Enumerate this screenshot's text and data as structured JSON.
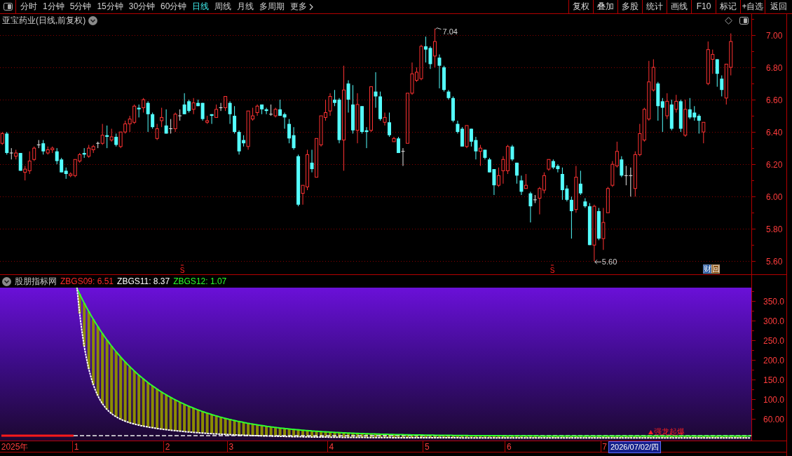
{
  "toolbar": {
    "periods": [
      {
        "label": "分时",
        "selected": false
      },
      {
        "label": "1分钟",
        "selected": false
      },
      {
        "label": "5分钟",
        "selected": false
      },
      {
        "label": "15分钟",
        "selected": false
      },
      {
        "label": "30分钟",
        "selected": false
      },
      {
        "label": "60分钟",
        "selected": false
      },
      {
        "label": "日线",
        "selected": true
      },
      {
        "label": "周线",
        "selected": false
      },
      {
        "label": "月线",
        "selected": false
      },
      {
        "label": "多周期",
        "selected": false
      }
    ],
    "more": {
      "label": "更多"
    },
    "actions": [
      "复权",
      "叠加",
      "多股",
      "统计",
      "画线",
      "F10",
      "标记",
      "+自选",
      "返回"
    ]
  },
  "main_chart": {
    "title": "亚宝药业(日线,前复权)",
    "chart_data": {
      "type": "candlestick",
      "ohlc": [
        [
          6.33,
          6.4,
          6.32,
          6.39
        ],
        [
          6.39,
          6.4,
          6.26,
          6.27
        ],
        [
          6.27,
          6.3,
          6.23,
          6.27
        ],
        [
          6.25,
          6.29,
          6.23,
          6.27
        ],
        [
          6.27,
          6.27,
          6.16,
          6.16
        ],
        [
          6.15,
          6.19,
          6.1,
          6.17
        ],
        [
          6.16,
          6.28,
          6.14,
          6.22
        ],
        [
          6.23,
          6.31,
          6.22,
          6.3
        ],
        [
          6.32,
          6.35,
          6.3,
          6.32
        ],
        [
          6.33,
          6.35,
          6.26,
          6.28
        ],
        [
          6.27,
          6.31,
          6.26,
          6.29
        ],
        [
          6.29,
          6.31,
          6.27,
          6.3
        ],
        [
          6.28,
          6.3,
          6.2,
          6.22
        ],
        [
          6.23,
          6.24,
          6.15,
          6.15
        ],
        [
          6.16,
          6.18,
          6.11,
          6.14
        ],
        [
          6.13,
          6.15,
          6.12,
          6.14
        ],
        [
          6.13,
          6.23,
          6.12,
          6.23
        ],
        [
          6.22,
          6.27,
          6.21,
          6.26
        ],
        [
          6.27,
          6.3,
          6.24,
          6.26
        ],
        [
          6.25,
          6.32,
          6.24,
          6.3
        ],
        [
          6.29,
          6.32,
          6.27,
          6.31
        ],
        [
          6.33,
          6.34,
          6.3,
          6.33
        ],
        [
          6.33,
          6.45,
          6.32,
          6.38
        ],
        [
          6.38,
          6.44,
          6.3,
          6.37
        ],
        [
          6.35,
          6.42,
          6.34,
          6.37
        ],
        [
          6.37,
          6.39,
          6.31,
          6.32
        ],
        [
          6.31,
          6.4,
          6.3,
          6.4
        ],
        [
          6.4,
          6.47,
          6.39,
          6.45
        ],
        [
          6.45,
          6.5,
          6.4,
          6.48
        ],
        [
          6.46,
          6.57,
          6.45,
          6.56
        ],
        [
          6.55,
          6.57,
          6.49,
          6.54
        ],
        [
          6.55,
          6.61,
          6.52,
          6.6
        ],
        [
          6.58,
          6.59,
          6.4,
          6.51
        ],
        [
          6.51,
          6.52,
          6.42,
          6.43
        ],
        [
          6.36,
          6.45,
          6.35,
          6.42
        ],
        [
          6.47,
          6.55,
          6.43,
          6.49
        ],
        [
          6.44,
          6.54,
          6.39,
          6.39
        ],
        [
          6.42,
          6.48,
          6.39,
          6.42
        ],
        [
          6.42,
          6.52,
          6.4,
          6.51
        ],
        [
          6.5,
          6.54,
          6.47,
          6.5
        ],
        [
          6.57,
          6.64,
          6.51,
          6.51
        ],
        [
          6.59,
          6.6,
          6.52,
          6.53
        ],
        [
          6.54,
          6.61,
          6.51,
          6.58
        ],
        [
          6.58,
          6.6,
          6.56,
          6.56
        ],
        [
          6.58,
          6.58,
          6.47,
          6.48
        ],
        [
          6.46,
          6.5,
          6.45,
          6.47
        ],
        [
          6.51,
          6.51,
          6.45,
          6.5
        ],
        [
          6.49,
          6.57,
          6.49,
          6.54
        ],
        [
          6.55,
          6.58,
          6.53,
          6.55
        ],
        [
          6.55,
          6.62,
          6.53,
          6.62
        ],
        [
          6.58,
          6.59,
          6.45,
          6.51
        ],
        [
          6.5,
          6.56,
          6.39,
          6.4
        ],
        [
          6.4,
          6.41,
          6.26,
          6.28
        ],
        [
          6.35,
          6.38,
          6.31,
          6.33
        ],
        [
          6.31,
          6.53,
          6.29,
          6.53
        ],
        [
          6.48,
          6.55,
          6.47,
          6.5
        ],
        [
          6.52,
          6.57,
          6.5,
          6.56
        ],
        [
          6.57,
          6.57,
          6.51,
          6.54
        ],
        [
          6.54,
          6.55,
          6.51,
          6.53
        ],
        [
          6.51,
          6.57,
          6.5,
          6.51
        ],
        [
          6.5,
          6.55,
          6.49,
          6.54
        ],
        [
          6.54,
          6.6,
          6.5,
          6.5
        ],
        [
          6.51,
          6.52,
          6.42,
          6.49
        ],
        [
          6.45,
          6.48,
          6.33,
          6.36
        ],
        [
          6.38,
          6.43,
          6.29,
          6.3
        ],
        [
          6.25,
          6.26,
          5.94,
          5.95
        ],
        [
          6.02,
          6.07,
          5.95,
          6.07
        ],
        [
          6.06,
          6.29,
          6.04,
          6.26
        ],
        [
          6.21,
          6.29,
          6.15,
          6.17
        ],
        [
          6.12,
          6.36,
          6.12,
          6.36
        ],
        [
          6.32,
          6.5,
          6.31,
          6.5
        ],
        [
          6.49,
          6.6,
          6.47,
          6.52
        ],
        [
          6.53,
          6.64,
          6.5,
          6.62
        ],
        [
          6.6,
          6.66,
          6.56,
          6.58
        ],
        [
          6.6,
          6.61,
          6.33,
          6.35
        ],
        [
          6.35,
          6.81,
          6.16,
          6.66
        ],
        [
          6.7,
          6.72,
          6.52,
          6.6
        ],
        [
          6.57,
          6.69,
          6.39,
          6.41
        ],
        [
          6.41,
          6.64,
          6.33,
          6.57
        ],
        [
          6.56,
          6.56,
          6.39,
          6.4
        ],
        [
          6.41,
          6.43,
          6.3,
          6.4
        ],
        [
          6.41,
          6.68,
          6.4,
          6.68
        ],
        [
          6.65,
          6.77,
          6.55,
          6.62
        ],
        [
          6.62,
          6.65,
          6.47,
          6.48
        ],
        [
          6.46,
          6.52,
          6.44,
          6.49
        ],
        [
          6.46,
          6.52,
          6.37,
          6.38
        ],
        [
          6.34,
          6.37,
          6.34,
          6.36
        ],
        [
          6.36,
          6.37,
          6.27,
          6.27
        ],
        [
          6.28,
          6.3,
          6.19,
          6.28
        ],
        [
          6.33,
          6.64,
          6.33,
          6.64
        ],
        [
          6.64,
          6.83,
          6.63,
          6.76
        ],
        [
          6.72,
          6.8,
          6.71,
          6.77
        ],
        [
          6.73,
          6.94,
          6.72,
          6.93
        ],
        [
          6.93,
          6.99,
          6.83,
          6.91
        ],
        [
          6.92,
          6.93,
          6.79,
          6.82
        ],
        [
          6.87,
          7.04,
          6.8,
          6.96
        ],
        [
          6.86,
          6.88,
          6.67,
          6.81
        ],
        [
          6.8,
          6.81,
          6.65,
          6.66
        ],
        [
          6.65,
          6.66,
          6.6,
          6.61
        ],
        [
          6.61,
          6.62,
          6.46,
          6.47
        ],
        [
          6.45,
          6.47,
          6.39,
          6.4
        ],
        [
          6.42,
          6.43,
          6.31,
          6.31
        ],
        [
          6.31,
          6.44,
          6.3,
          6.44
        ],
        [
          6.42,
          6.42,
          6.31,
          6.34
        ],
        [
          6.35,
          6.37,
          6.23,
          6.28
        ],
        [
          6.28,
          6.32,
          6.19,
          6.3
        ],
        [
          6.29,
          6.29,
          6.23,
          6.24
        ],
        [
          6.23,
          6.24,
          6.15,
          6.15
        ],
        [
          6.17,
          6.17,
          6.01,
          6.07
        ],
        [
          6.07,
          6.18,
          6.06,
          6.13
        ],
        [
          6.16,
          6.25,
          6.08,
          6.23
        ],
        [
          6.16,
          6.32,
          6.14,
          6.31
        ],
        [
          6.31,
          6.32,
          6.22,
          6.23
        ],
        [
          6.21,
          6.21,
          6.08,
          6.13
        ],
        [
          6.1,
          6.13,
          6.01,
          6.03
        ],
        [
          6.05,
          6.14,
          6.05,
          6.07
        ],
        [
          6.02,
          6.03,
          5.84,
          5.94
        ],
        [
          5.98,
          6.01,
          5.96,
          5.98
        ],
        [
          5.99,
          6.06,
          5.89,
          6.05
        ],
        [
          6.04,
          6.15,
          6.02,
          6.13
        ],
        [
          6.17,
          6.23,
          6.16,
          6.23
        ],
        [
          6.22,
          6.23,
          6.17,
          6.18
        ],
        [
          6.19,
          6.2,
          6.15,
          6.17
        ],
        [
          6.14,
          6.18,
          5.98,
          6.04
        ],
        [
          6.05,
          6.07,
          5.97,
          5.98
        ],
        [
          5.98,
          6.0,
          5.74,
          5.91
        ],
        [
          5.92,
          6.19,
          5.9,
          6.12
        ],
        [
          6.08,
          6.16,
          6.01,
          6.02
        ],
        [
          5.97,
          5.99,
          5.93,
          5.94
        ],
        [
          5.94,
          5.96,
          5.7,
          5.7
        ],
        [
          5.7,
          5.95,
          5.6,
          5.94
        ],
        [
          5.91,
          5.93,
          5.73,
          5.74
        ],
        [
          5.74,
          5.93,
          5.67,
          5.84
        ],
        [
          5.9,
          6.06,
          5.9,
          6.05
        ],
        [
          6.07,
          6.22,
          6.06,
          6.2
        ],
        [
          6.19,
          6.34,
          6.18,
          6.28
        ],
        [
          6.23,
          6.25,
          6.12,
          6.13
        ],
        [
          6.13,
          6.19,
          6.07,
          6.13
        ],
        [
          6.13,
          6.18,
          6.0,
          6.13
        ],
        [
          6.05,
          6.28,
          6.0,
          6.26
        ],
        [
          6.26,
          6.45,
          6.25,
          6.39
        ],
        [
          6.35,
          6.55,
          6.34,
          6.54
        ],
        [
          6.48,
          6.84,
          6.47,
          6.71
        ],
        [
          6.66,
          6.85,
          6.65,
          6.8
        ],
        [
          6.7,
          6.71,
          6.47,
          6.56
        ],
        [
          6.59,
          6.61,
          6.4,
          6.55
        ],
        [
          6.5,
          6.64,
          6.48,
          6.59
        ],
        [
          6.57,
          6.6,
          6.41,
          6.42
        ],
        [
          6.54,
          6.63,
          6.52,
          6.59
        ],
        [
          6.59,
          6.6,
          6.4,
          6.42
        ],
        [
          6.38,
          6.6,
          6.37,
          6.54
        ],
        [
          6.54,
          6.61,
          6.48,
          6.49
        ],
        [
          6.52,
          6.56,
          6.47,
          6.49
        ],
        [
          6.5,
          6.51,
          6.39,
          6.47
        ],
        [
          6.4,
          6.46,
          6.33,
          6.46
        ],
        [
          6.7,
          6.96,
          6.69,
          6.91
        ],
        [
          6.85,
          6.91,
          6.76,
          6.88
        ],
        [
          6.85,
          6.85,
          6.68,
          6.76
        ],
        [
          6.73,
          6.75,
          6.62,
          6.66
        ],
        [
          6.61,
          6.82,
          6.57,
          6.82
        ],
        [
          6.8,
          7.01,
          6.75,
          6.96
        ],
        null,
        null,
        null,
        null
      ],
      "ylim": [
        4.49,
        7.13
      ],
      "yticks": [
        {
          "value": 7.0,
          "label": "7.00"
        },
        {
          "value": 6.8,
          "label": "6.80"
        },
        {
          "value": 6.6,
          "label": "6.60"
        },
        {
          "value": 6.4,
          "label": "6.40"
        },
        {
          "value": 6.2,
          "label": "6.20"
        },
        {
          "value": 6.0,
          "label": "6.00"
        },
        {
          "value": 5.8,
          "label": "5.80"
        },
        {
          "value": 5.6,
          "label": "5.60"
        }
      ],
      "grid": true,
      "annotations": [
        "7.04",
        "5.60"
      ]
    },
    "signals": [
      "S",
      "S"
    ],
    "badges": [
      {
        "label": "财",
        "color": "#1c4f9c"
      },
      {
        "label": "回",
        "color": "#8a5216"
      }
    ]
  },
  "indicator": {
    "name": "股朋指标网",
    "legend": [
      {
        "label": "ZBGS09: 6.51",
        "color": "#ff2a2a"
      },
      {
        "label": "ZBGS11: 8.37",
        "color": "#ffffff"
      },
      {
        "label": "ZBGS12: 1.07",
        "color": "#2aff2a"
      }
    ],
    "axis_labels": [
      "350.0",
      "300.0",
      "250.0",
      "200.0",
      "150.0",
      "100.0",
      "60.00"
    ],
    "signal_text": "强龙起爆"
  },
  "time_axis": {
    "labels": [
      "2025年",
      "1",
      "2",
      "3",
      "4",
      "5",
      "6",
      "7"
    ],
    "cursor_date": "2026/07/02/四"
  }
}
